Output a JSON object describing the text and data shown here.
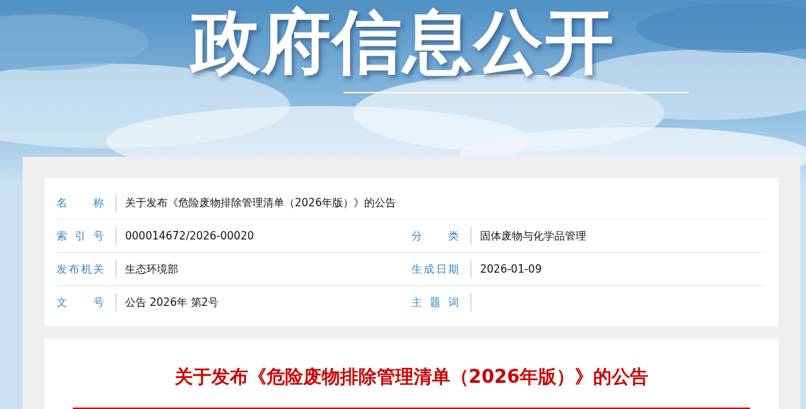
{
  "banner": {
    "title": "政府信息公开",
    "kind": "picture"
  },
  "info": {
    "rows": [
      [
        {
          "label": "名称",
          "value": "关于发布《危险废物排除管理清单（2026年版）》的公告"
        }
      ],
      [
        {
          "label": "索引号",
          "value": "000014672/2026-00020"
        },
        {
          "label": "分类",
          "value": "固体废物与化学品管理"
        }
      ],
      [
        {
          "label": "发布机关",
          "value": "生态环境部"
        },
        {
          "label": "生成日期",
          "value": "2026-01-09"
        }
      ],
      [
        {
          "label": "文号",
          "value": "公告 2026年 第2号"
        },
        {
          "label": "主题词"
        }
      ]
    ]
  },
  "article": {
    "title": "关于发布《危险废物排除管理清单（2026年版）》的公告"
  }
}
